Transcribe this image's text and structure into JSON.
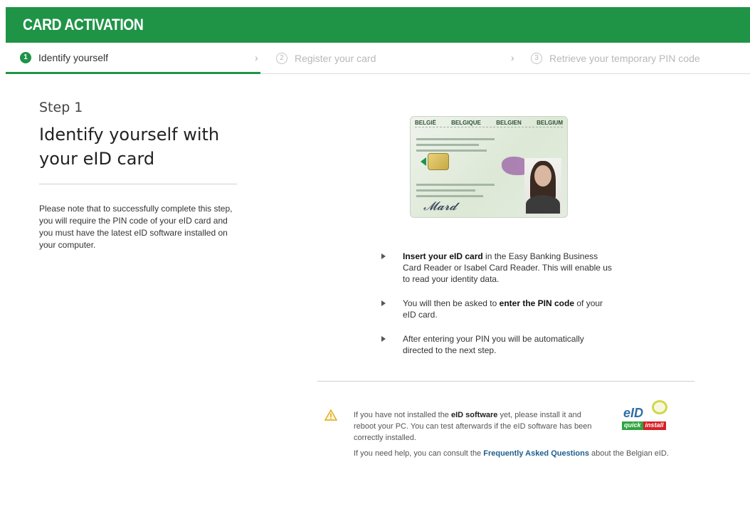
{
  "header": {
    "title": "CARD ACTIVATION"
  },
  "steps": [
    {
      "number": "1",
      "label": "Identify yourself"
    },
    {
      "number": "2",
      "label": "Register your card"
    },
    {
      "number": "3",
      "label": "Retrieve your temporary PIN code"
    }
  ],
  "step_separator": "›",
  "left": {
    "kicker": "Step 1",
    "title": "Identify yourself with your eID card",
    "note": "Please note that to successfully complete this step, you will require the PIN code of your eID card and you must have the latest eID software installed on your computer."
  },
  "card": {
    "countries": [
      "BELGIË",
      "BELGIQUE",
      "BELGIEN",
      "BELGIUM"
    ],
    "icon": "belgian-eid-card-image"
  },
  "instructions": [
    {
      "bold": "Insert your eID card",
      "rest": " in the Easy Banking Business Card Reader or Isabel Card Reader. This will enable us to read your identity data."
    },
    {
      "pre": "You will then be asked to ",
      "bold": "enter the PIN code",
      "rest": " of your eID card."
    },
    {
      "pre": "After entering your PIN you will be automatically directed to the next step."
    }
  ],
  "warning": {
    "icon": "warning-icon",
    "pre": "If you have not installed the ",
    "bold": "eID software",
    "rest": " yet, please install it and reboot your PC. You can test afterwards if the eID software has been correctly installed."
  },
  "eid_logo": {
    "word": "eID",
    "quick": "quick",
    "install": "install"
  },
  "help": {
    "pre": "If you need help, you can consult the ",
    "link": "Frequently Asked Questions",
    "post": " about the Belgian eID."
  },
  "colors": {
    "brand_green": "#1f9446",
    "link_blue": "#1c5f8e"
  }
}
